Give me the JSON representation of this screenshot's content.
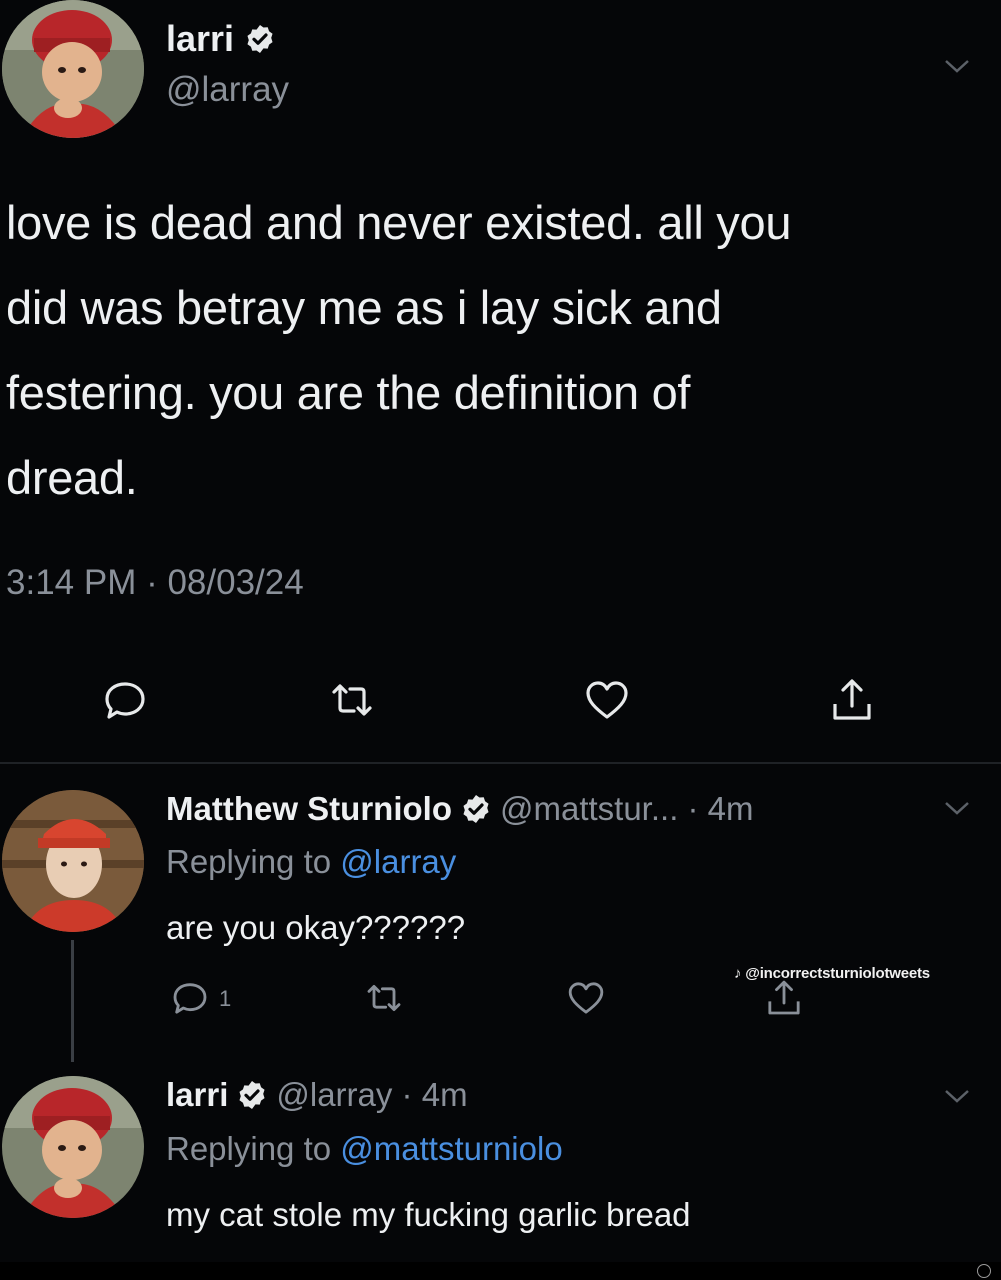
{
  "main_tweet": {
    "author": {
      "name": "larri",
      "handle": "@larray",
      "verified": true
    },
    "text_lines": [
      "love is dead and never existed. all you",
      "did was betray me as i lay sick and",
      "festering. you are the definition of",
      "dread."
    ],
    "timestamp": "3:14 PM · 08/03/24",
    "actions": [
      "reply-icon",
      "retweet-icon",
      "like-icon",
      "share-icon"
    ]
  },
  "replies": [
    {
      "author_name": "Matthew Sturniolo",
      "handle_time": "@mattstur... · 4m",
      "verified": true,
      "replying_prefix": "Replying to ",
      "replying_to": "@larray",
      "text": "are you okay??????",
      "reply_count": "1"
    },
    {
      "author_name": "larri",
      "handle_time": "@larray · 4m",
      "verified": true,
      "replying_prefix": "Replying to ",
      "replying_to": "@mattsturniolo",
      "text": "my cat stole my fucking garlic bread"
    }
  ],
  "watermark": "♪ @incorrectsturniolotweets",
  "colors": {
    "background": "#050608",
    "text": "#eef0f2",
    "secondary": "#8a9099",
    "link": "#4a8fe0",
    "badge": "#e7e9ea"
  }
}
